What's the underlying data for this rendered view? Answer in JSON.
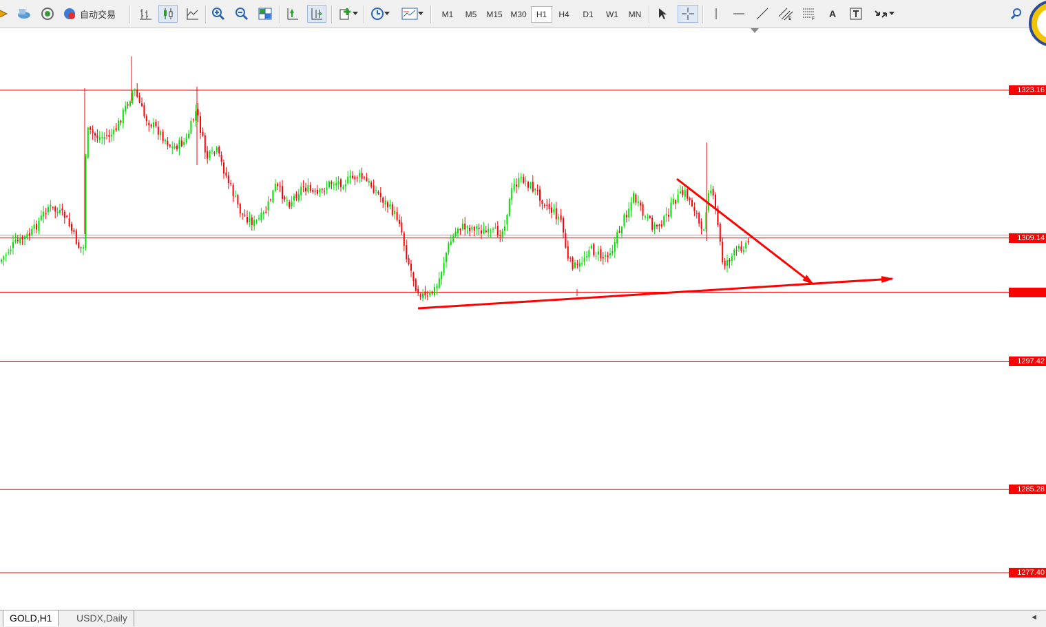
{
  "toolbar": {
    "auto_trading_label": "自动交易",
    "timeframes": [
      "M1",
      "M5",
      "M15",
      "M30",
      "H1",
      "H4",
      "D1",
      "W1",
      "MN"
    ],
    "active_timeframe": "H1",
    "text_tool_label": "A"
  },
  "chart": {
    "symbol": "GOLD",
    "timeframe": "H1",
    "bull_color": "#00e000",
    "bear_color": "#ff0000",
    "line_color": "#ff0000",
    "price_levels": [
      {
        "price": 1323.16,
        "label": "1323.16"
      },
      {
        "price": 1309.14,
        "label": "1309.14"
      },
      {
        "price": 1304.0,
        "label": ""
      },
      {
        "price": 1297.42,
        "label": "1297.42"
      },
      {
        "price": 1285.28,
        "label": "1285.28"
      },
      {
        "price": 1277.4,
        "label": "1277.40"
      }
    ]
  },
  "tabs": [
    {
      "label": "GOLD,H1",
      "active": true
    },
    {
      "label": "USDX,Daily",
      "active": false
    }
  ]
}
